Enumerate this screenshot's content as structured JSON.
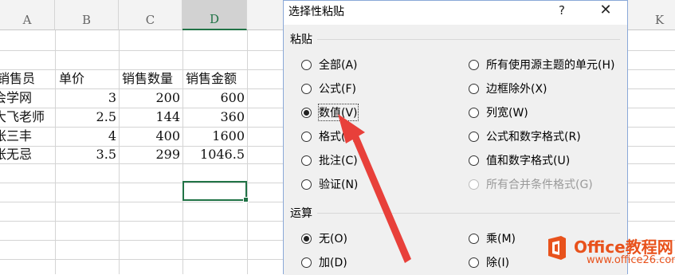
{
  "sheet": {
    "columns": [
      "A",
      "B",
      "C",
      "D",
      "",
      "",
      "",
      "",
      "",
      "",
      "K"
    ],
    "selected_column": "D",
    "headers": [
      "销售员",
      "单价",
      "销售数量",
      "销售金额"
    ],
    "rows": [
      [
        "会学网",
        "3",
        "200",
        "600"
      ],
      [
        "大飞老师",
        "2.5",
        "144",
        "360"
      ],
      [
        "张三丰",
        "4",
        "400",
        "1600"
      ],
      [
        "张无忌",
        "3.5",
        "299",
        "1046.5"
      ]
    ]
  },
  "dialog": {
    "title": "选择性粘贴",
    "help": "?",
    "close": "✕",
    "paste_section": "粘贴",
    "paste_left": [
      "全部(A)",
      "公式(F)",
      "数值(V)",
      "格式(T)",
      "批注(C)",
      "验证(N)"
    ],
    "paste_right": [
      "所有使用源主题的单元(H)",
      "边框除外(X)",
      "列宽(W)",
      "公式和数字格式(R)",
      "值和数字格式(U)",
      "所有合并条件格式(G)"
    ],
    "paste_selected": "数值(V)",
    "operation_section": "运算",
    "op_left": [
      "无(O)",
      "加(D)"
    ],
    "op_right": [
      "乘(M)",
      "除(I)"
    ],
    "op_selected": "无(O)"
  },
  "watermark": {
    "brand": "Office教程网",
    "url": "www.office26.com",
    "color": "#e8521c"
  },
  "colors": {
    "accent": "#217346",
    "arrow": "#e8403a"
  }
}
